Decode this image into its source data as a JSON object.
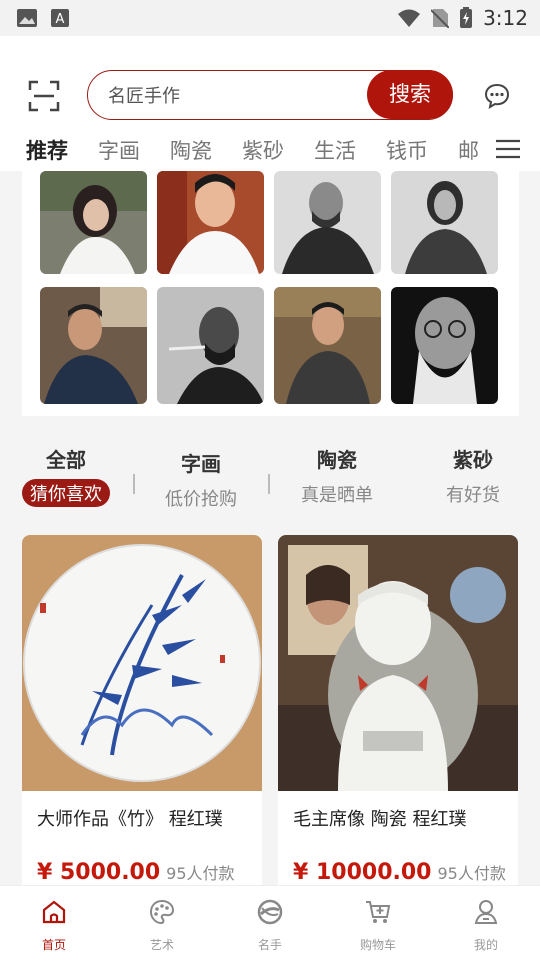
{
  "status_bar": {
    "time": "3:12"
  },
  "search": {
    "placeholder": "名匠手作",
    "button_label": "搜索"
  },
  "tabs": [
    {
      "label": "推荐",
      "active": true
    },
    {
      "label": "字画"
    },
    {
      "label": "陶瓷"
    },
    {
      "label": "紫砂"
    },
    {
      "label": "生活"
    },
    {
      "label": "钱币"
    },
    {
      "label": "邮"
    }
  ],
  "categories": [
    {
      "title": "全部",
      "subtitle": "猜你喜欢",
      "active": true
    },
    {
      "title": "字画",
      "subtitle": "低价抢购"
    },
    {
      "title": "陶瓷",
      "subtitle": "真是晒单"
    },
    {
      "title": "紫砂",
      "subtitle": "有好货"
    }
  ],
  "products": [
    {
      "title": "大师作品《竹》 程红璞",
      "price": "¥ 5000.00",
      "paid": "95人付款"
    },
    {
      "title": "毛主席像 陶瓷 程红璞",
      "price": "¥ 10000.00",
      "paid": "95人付款"
    }
  ],
  "bottom_nav": [
    {
      "label": "首页",
      "icon": "home-icon",
      "active": true
    },
    {
      "label": "艺术",
      "icon": "palette-icon"
    },
    {
      "label": "名手",
      "icon": "master-icon"
    },
    {
      "label": "购物车",
      "icon": "cart-icon"
    },
    {
      "label": "我的",
      "icon": "profile-icon"
    }
  ],
  "colors": {
    "brand": "#b0150c",
    "price": "#c4180b"
  }
}
